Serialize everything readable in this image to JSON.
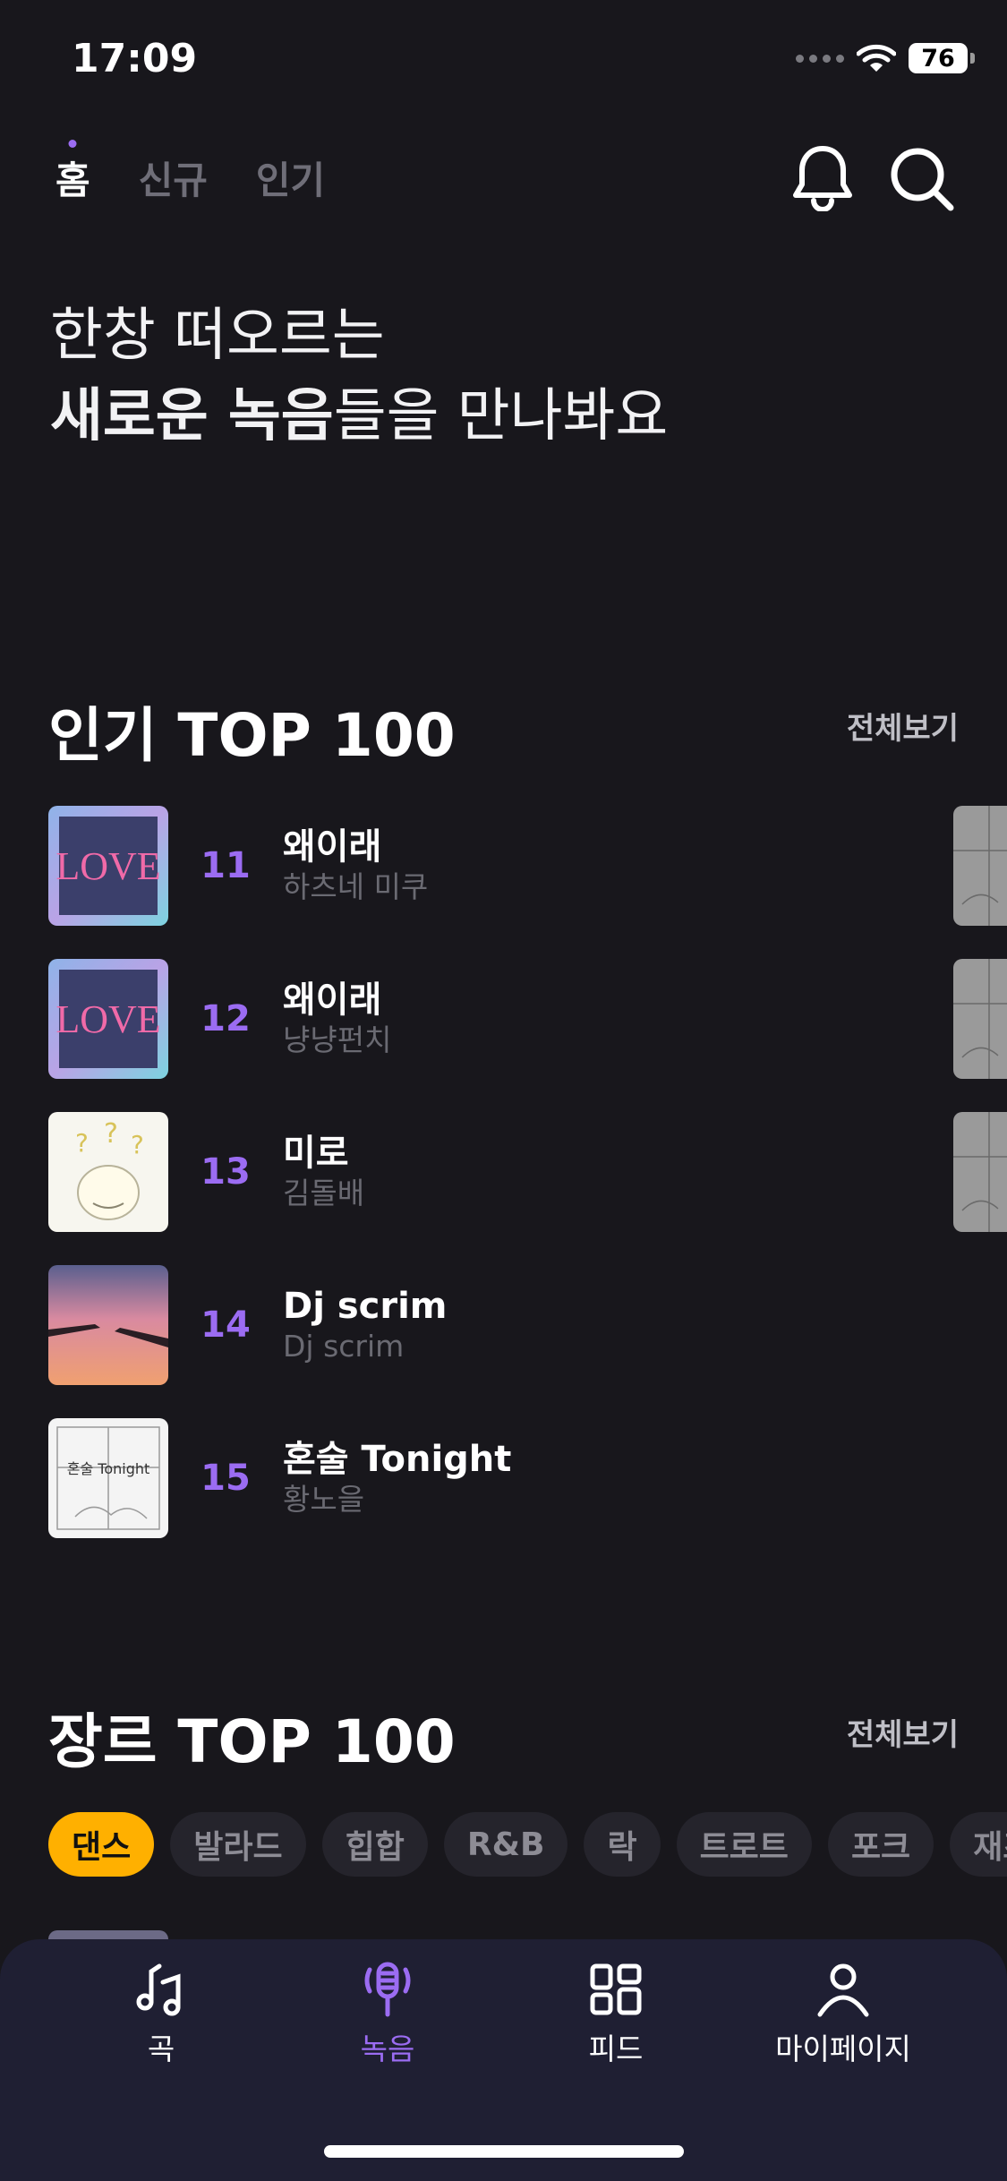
{
  "status": {
    "time": "17:09",
    "battery": "76"
  },
  "tabs": [
    {
      "label": "홈",
      "active": true
    },
    {
      "label": "신규",
      "active": false
    },
    {
      "label": "인기",
      "active": false
    }
  ],
  "hero": {
    "line1": "한창 떠오르는",
    "line2_bold": "새로운 녹음",
    "line2_rest": "들을 만나봐요"
  },
  "popular": {
    "title": "인기 TOP 100",
    "see_all": "전체보기",
    "items": [
      {
        "rank": "11",
        "title": "왜이래",
        "artist": "하츠네 미쿠"
      },
      {
        "rank": "12",
        "title": "왜이래",
        "artist": "냥냥펀치"
      },
      {
        "rank": "13",
        "title": "미로",
        "artist": "김돌배"
      },
      {
        "rank": "14",
        "title": "Dj scrim",
        "artist": "Dj scrim"
      },
      {
        "rank": "15",
        "title": "혼술 Tonight",
        "artist": "황노을"
      }
    ]
  },
  "genre": {
    "title": "장르 TOP 100",
    "see_all": "전체보기",
    "chips": [
      "댄스",
      "발라드",
      "힙합",
      "R&B",
      "락",
      "트로트",
      "포크",
      "재즈"
    ],
    "active_index": 0
  },
  "nav": [
    {
      "label": "곡",
      "icon": "music-note-icon"
    },
    {
      "label": "녹음",
      "icon": "microphone-icon",
      "active": true
    },
    {
      "label": "피드",
      "icon": "grid-icon"
    },
    {
      "label": "마이페이지",
      "icon": "person-icon"
    }
  ],
  "colors": {
    "accent": "#9b6cf2",
    "chip_active": "#ffb000",
    "background": "#18171c"
  }
}
